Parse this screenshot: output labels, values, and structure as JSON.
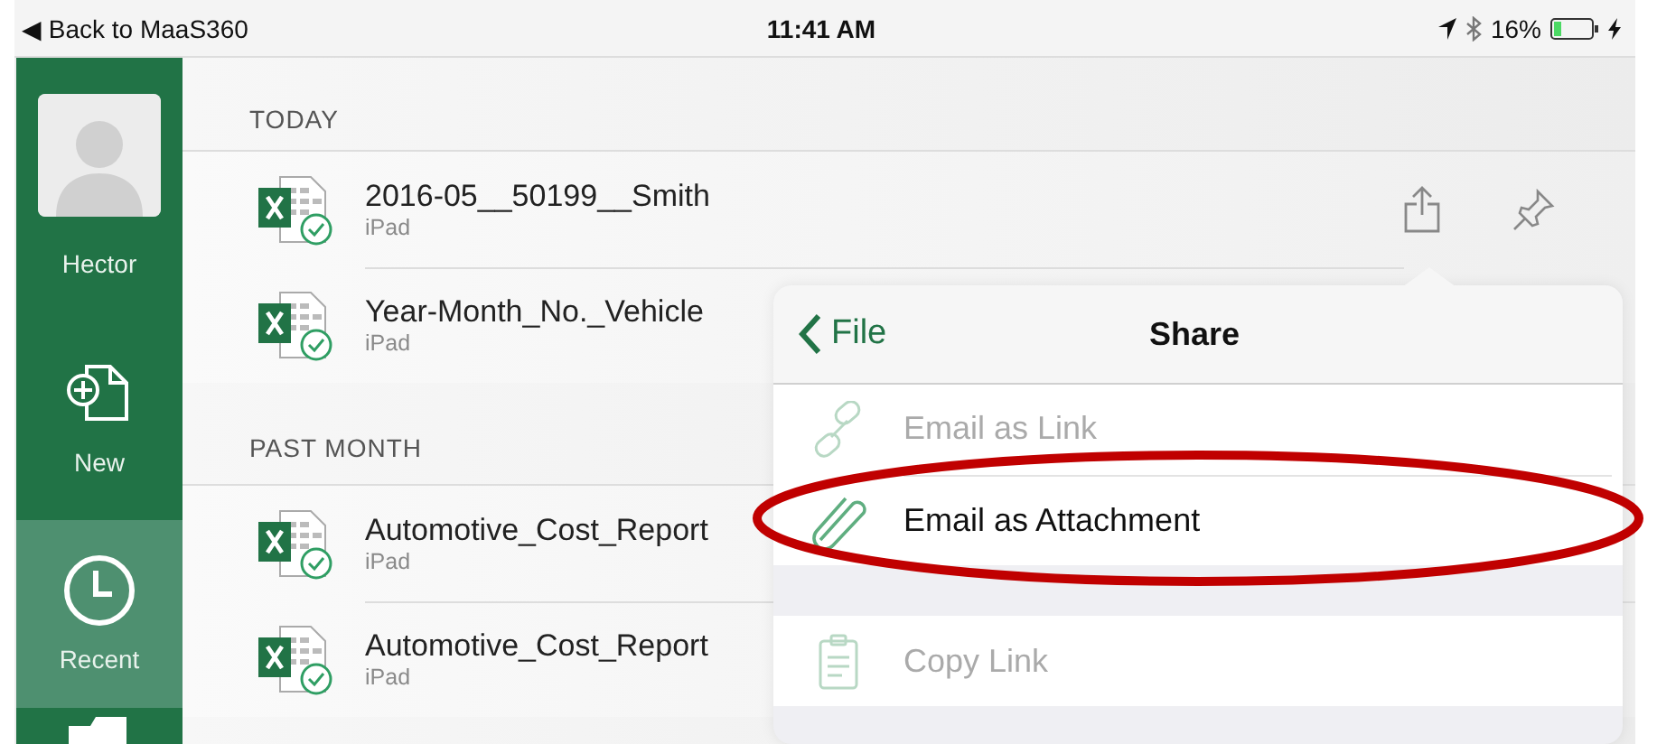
{
  "status_bar": {
    "back_label": "◀ Back to MaaS360",
    "time": "11:41 AM",
    "battery": "16%"
  },
  "sidebar": {
    "items": [
      {
        "kind": "account",
        "label": "Hector",
        "selected": false
      },
      {
        "kind": "new",
        "label": "New",
        "selected": false
      },
      {
        "kind": "recent",
        "label": "Recent",
        "selected": true
      },
      {
        "kind": "folder",
        "selected": false
      }
    ]
  },
  "sections": [
    {
      "title": "TODAY",
      "files": [
        {
          "name": "2016-05__50199__Smith",
          "location": "iPad",
          "actions": true
        },
        {
          "name": "Year-Month_No._Vehicle",
          "location": "iPad",
          "actions": false
        }
      ]
    },
    {
      "title": "PAST MONTH",
      "files": [
        {
          "name": "Automotive_Cost_Report",
          "location": "iPad",
          "actions": false
        },
        {
          "name": "Automotive_Cost_Report",
          "location": "iPad",
          "actions": false
        }
      ]
    }
  ],
  "popover": {
    "back_label": "File",
    "title": "Share",
    "groups": [
      [
        {
          "kind": "link",
          "label": "Email as Link",
          "disabled": true,
          "highlighted": false
        },
        {
          "kind": "attachment",
          "label": "Email as Attachment",
          "disabled": false,
          "highlighted": true
        }
      ],
      [
        {
          "kind": "clipboard",
          "label": "Copy Link",
          "disabled": true,
          "highlighted": false
        }
      ]
    ]
  }
}
